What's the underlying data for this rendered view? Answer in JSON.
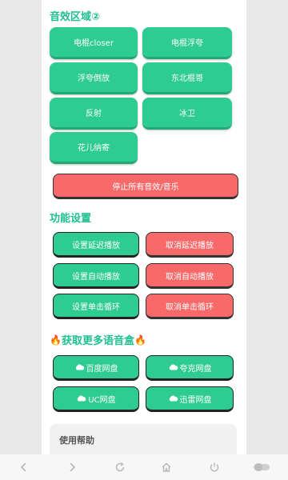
{
  "effects": {
    "title": "音效区域②",
    "buttons": [
      "电棍closer",
      "电棍浮夸",
      "浮夸倒放",
      "东北棍哥",
      "反射",
      "冰卫",
      "花儿纳寄"
    ],
    "stop_all": "停止所有音效/音乐"
  },
  "settings": {
    "title": "功能设置",
    "rows": [
      {
        "set": "设置延迟播放",
        "cancel": "取消延迟播放"
      },
      {
        "set": "设置自动播放",
        "cancel": "取消自动播放"
      },
      {
        "set": "设置单击循环",
        "cancel": "取消单击循环"
      }
    ]
  },
  "more": {
    "title": "获取更多语音盒",
    "disks": [
      "百度网盘",
      "夸克网盘",
      "UC网盘",
      "迅雷网盘"
    ]
  },
  "help": {
    "title": "使用帮助"
  },
  "colors": {
    "accent": "#1fbf8f",
    "green_button": "#2ecc93",
    "red_button": "#f86a6a"
  },
  "icons": [
    "fire-icon",
    "cloud-icon",
    "back-icon",
    "forward-icon",
    "refresh-icon",
    "home-icon",
    "power-icon",
    "toggle-icon"
  ]
}
